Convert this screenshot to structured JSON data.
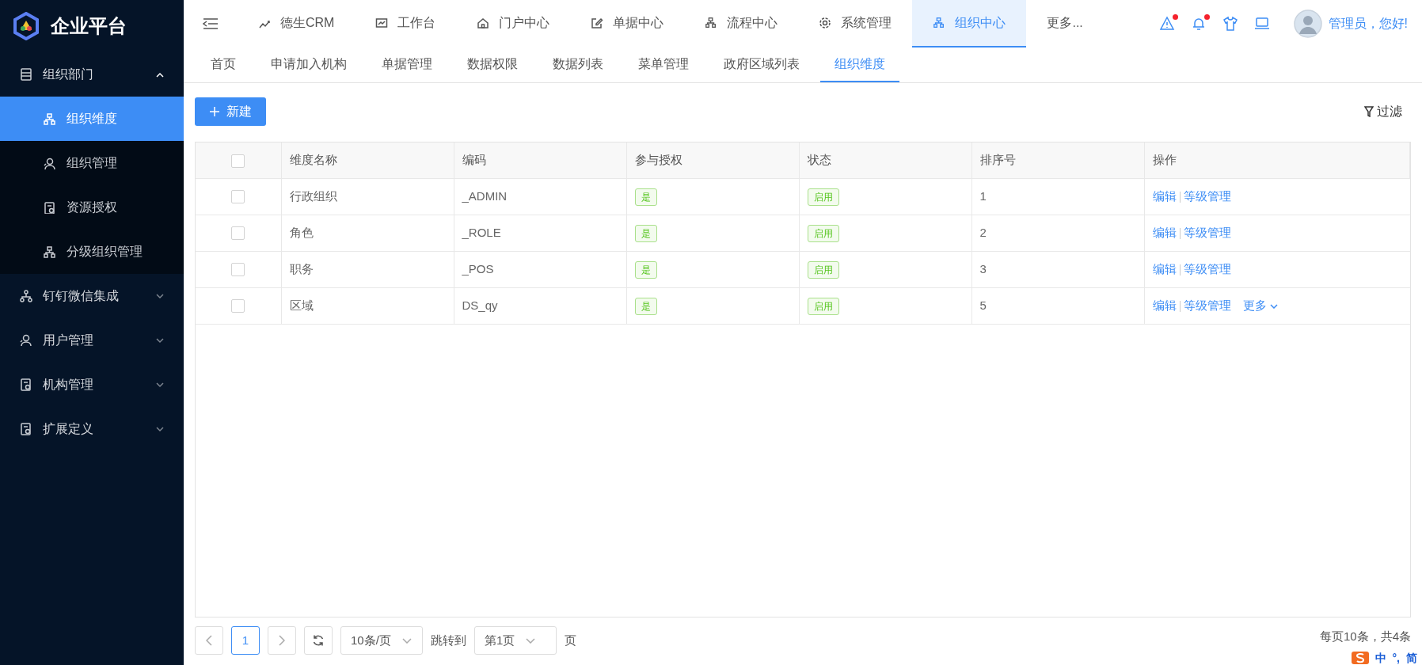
{
  "brand": {
    "name": "企业平台"
  },
  "sidebar": {
    "items": [
      {
        "label": "组织部门",
        "expanded": true,
        "children": [
          {
            "label": "组织维度",
            "selected": true
          },
          {
            "label": "组织管理",
            "selected": false
          },
          {
            "label": "资源授权",
            "selected": false
          },
          {
            "label": "分级组织管理",
            "selected": false
          }
        ]
      },
      {
        "label": "钉钉微信集成",
        "expanded": false
      },
      {
        "label": "用户管理",
        "expanded": false
      },
      {
        "label": "机构管理",
        "expanded": false
      },
      {
        "label": "扩展定义",
        "expanded": false
      }
    ]
  },
  "top_nav": {
    "items": [
      {
        "label": "德生CRM",
        "selected": false
      },
      {
        "label": "工作台",
        "selected": false
      },
      {
        "label": "门户中心",
        "selected": false
      },
      {
        "label": "单据中心",
        "selected": false
      },
      {
        "label": "流程中心",
        "selected": false
      },
      {
        "label": "系统管理",
        "selected": false
      },
      {
        "label": "组织中心",
        "selected": true
      }
    ],
    "more": "更多..."
  },
  "header_icons": [
    {
      "badge": true
    },
    {
      "badge": true
    },
    {
      "badge": false
    },
    {
      "badge": false
    }
  ],
  "user": {
    "greeting": "管理员，您好!"
  },
  "tabs": [
    {
      "label": "首页",
      "selected": false
    },
    {
      "label": "申请加入机构",
      "selected": false
    },
    {
      "label": "单据管理",
      "selected": false
    },
    {
      "label": "数据权限",
      "selected": false
    },
    {
      "label": "数据列表",
      "selected": false
    },
    {
      "label": "菜单管理",
      "selected": false
    },
    {
      "label": "政府区域列表",
      "selected": false
    },
    {
      "label": "组织维度",
      "selected": true
    }
  ],
  "toolbar": {
    "new_button": "新建",
    "filter": "过滤"
  },
  "table": {
    "header_checked": false,
    "columns": [
      "维度名称",
      "编码",
      "参与授权",
      "状态",
      "排序号",
      "操作"
    ],
    "rows": [
      {
        "checked": false,
        "name": "行政组织",
        "code": "_ADMIN",
        "auth": "是",
        "status": "启用",
        "order": "1",
        "actions": [
          "编辑",
          "等级管理"
        ]
      },
      {
        "checked": false,
        "name": "角色",
        "code": "_ROLE",
        "auth": "是",
        "status": "启用",
        "order": "2",
        "actions": [
          "编辑",
          "等级管理"
        ]
      },
      {
        "checked": false,
        "name": "职务",
        "code": "_POS",
        "auth": "是",
        "status": "启用",
        "order": "3",
        "actions": [
          "编辑",
          "等级管理"
        ]
      },
      {
        "checked": false,
        "name": "区域",
        "code": "DS_qy",
        "auth": "是",
        "status": "启用",
        "order": "5",
        "actions": [
          "编辑",
          "等级管理"
        ],
        "more": "更多"
      }
    ]
  },
  "pagination": {
    "pages": [
      {
        "label": "1",
        "selected": true
      }
    ],
    "page_size": "10条/页",
    "jump_label": "跳转到",
    "jump_value": "第1页",
    "page_unit": "页",
    "summary": "每页10条，共4条"
  },
  "ime": {
    "labels": [
      "中",
      "°,",
      "简"
    ]
  }
}
